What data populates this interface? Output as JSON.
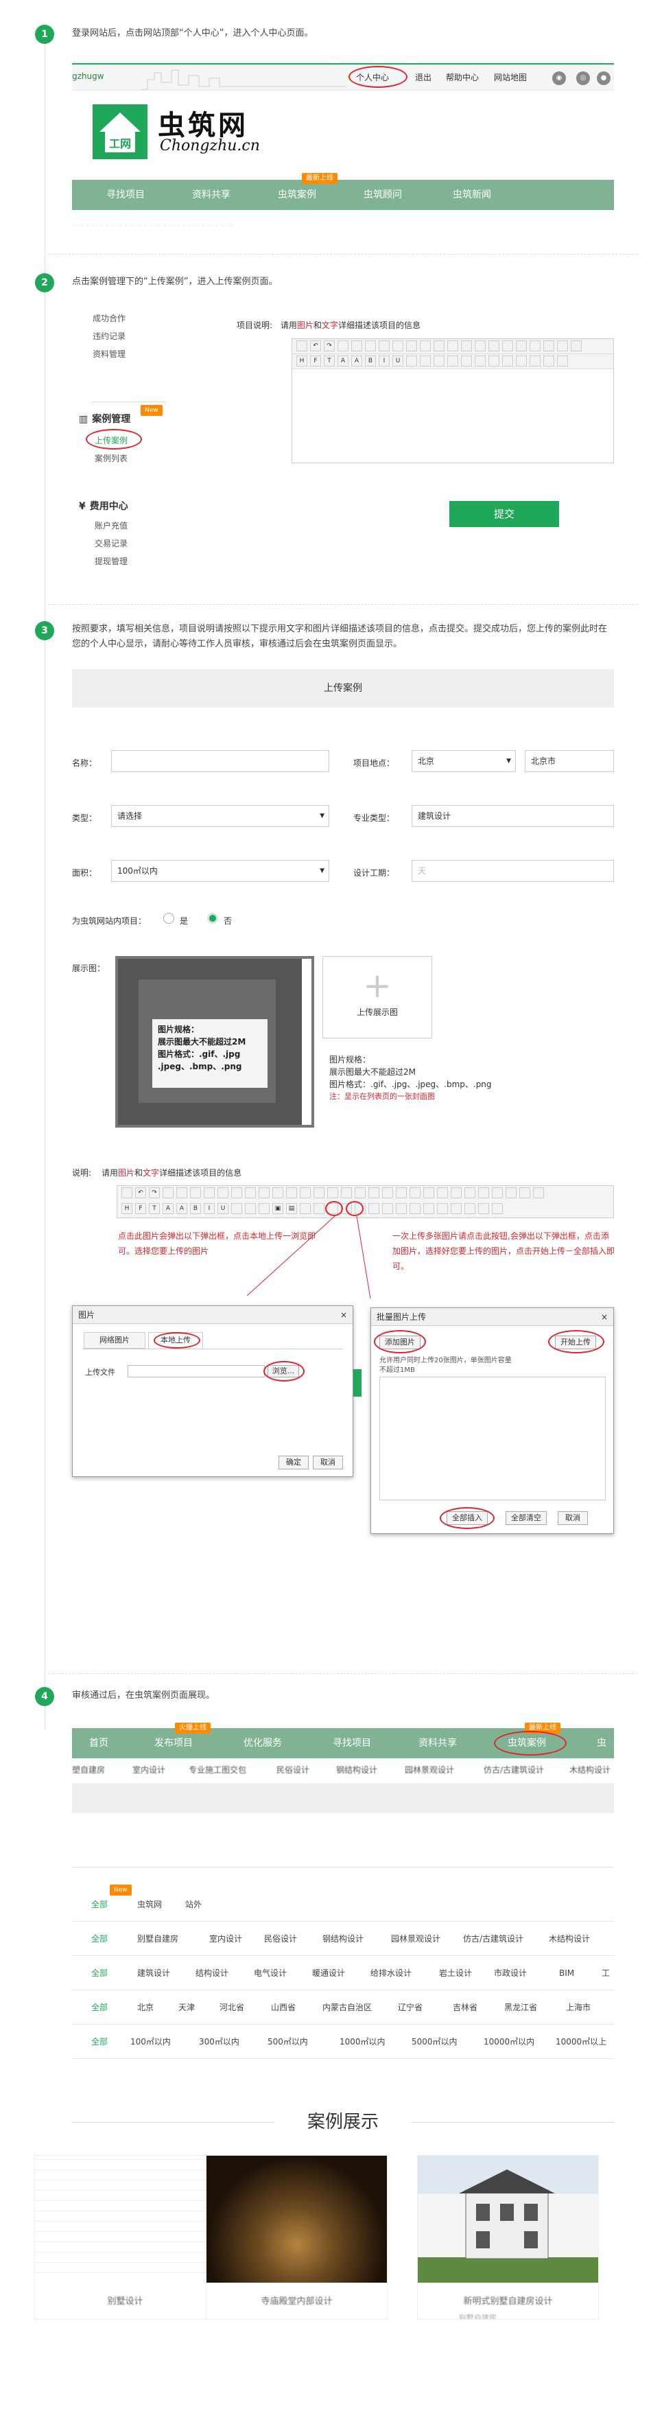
{
  "steps": [
    {
      "num": "1",
      "text": "登录网站后，点击网站顶部“个人中心”，进入个人中心页面。"
    },
    {
      "num": "2",
      "text": "点击案例管理下的“上传案例”，进入上传案例页面。"
    },
    {
      "num": "3",
      "text": "按照要求，填写相关信息，项目说明请按照以下提示用文字和图片详细描述该项目的信息，点击提交。提交成功后，您上传的案例此时在您的个人中心显示，请耐心等待工作人员审核，审核通过后会在虫筑案例页面显示。"
    },
    {
      "num": "4",
      "text": "审核通过后，在虫筑案例页面展现。"
    }
  ],
  "s1": {
    "username": "gzhugw",
    "top_links": [
      "个人中心",
      "退出",
      "帮助中心",
      "网站地图"
    ],
    "logo_cn": "虫筑网",
    "logo_en": "Chongzhu.cn",
    "logo_mark": "工网",
    "badge": "最新上线",
    "nav": [
      "寻找项目",
      "资料共享",
      "虫筑案例",
      "虫筑顾问",
      "虫筑新闻"
    ]
  },
  "s2": {
    "menu_top": [
      "成功合作",
      "违约记录",
      "资料管理"
    ],
    "case_title": "案例管理",
    "new_badge": "New",
    "case_items": [
      "上传案例",
      "案例列表"
    ],
    "fee_title": "费用中心",
    "fee_items": [
      "账户充值",
      "交易记录",
      "提现管理"
    ],
    "desc_label": "项目说明:",
    "desc_hint_pre": "请用",
    "desc_hint_img": "图片",
    "desc_hint_and": "和",
    "desc_hint_text": "文字",
    "desc_hint_post": "详细描述该项目的信息",
    "submit": "提交"
  },
  "s3": {
    "form_title": "上传案例",
    "name_label": "名称：",
    "location_label": "项目地点：",
    "province": "北京",
    "city": "北京市",
    "type_label": "类型：",
    "type_value": "请选择",
    "major_label": "专业类型：",
    "major_value": "建筑设计",
    "area_label": "面积：",
    "area_value": "100㎡以内",
    "period_label": "设计工期：",
    "period_placeholder": "天",
    "internal_label": "为虫筑网站内项目：",
    "opt_yes": "是",
    "opt_no": "否",
    "display_label": "展示图：",
    "preview_lines": [
      "图片规格：",
      "展示图最大不能超过2M",
      "图片格式：.gif、.jpg",
      ".jpeg、.bmp、.png"
    ],
    "upload_btn": "上传展示图",
    "spec_lines": [
      "图片规格：",
      "展示图最大不能超过2M",
      "图片格式：.gif、.jpg、.jpeg、.bmp、.png"
    ],
    "spec_note": "注：显示在列表页的一张封面图",
    "desc_label": "说明:",
    "annot_left": "点击此图片会弹出以下弹出框，点击本地上传一浏览即可。选择您要上传的图片",
    "annot_right": "一次上传多张图片请点击此按钮,会弹出以下弹出框，点击添加图片，选择好您要上传的图片，点击开始上传－全部插入即可。",
    "dlg1_title": "图片",
    "dlg1_tabs": [
      "网络图片",
      "本地上传"
    ],
    "dlg1_file_label": "上传文件",
    "dlg1_browse": "浏览...",
    "dlg1_ok": "确定",
    "dlg1_cancel": "取消",
    "dlg2_title": "批量图片上传",
    "dlg2_add": "添加图片",
    "dlg2_start": "开始上传",
    "dlg2_note": "允许用户同时上传20张图片，单张图片容量不超过1MB",
    "dlg2_insert": "全部插入",
    "dlg2_clear": "全部清空",
    "dlg2_cancel": "取消",
    "close": "×"
  },
  "s4": {
    "nav": [
      "首页",
      "发布项目",
      "优化服务",
      "寻找项目",
      "资料共享",
      "虫筑案例",
      "虫"
    ],
    "badge1": "火爆上线",
    "badge2": "最新上线",
    "subnav": [
      "塑自建房",
      "室内设计",
      "专业施工图交包",
      "民俗设计",
      "钢结构设计",
      "园林景观设计",
      "仿古/古建筑设计",
      "木结构设计"
    ]
  },
  "filters": {
    "new_badge": "New",
    "rows": [
      [
        "全部",
        "虫筑网",
        "站外"
      ],
      [
        "全部",
        "别墅自建房",
        "室内设计",
        "民俗设计",
        "钢结构设计",
        "园林景观设计",
        "仿古/古建筑设计",
        "木结构设计"
      ],
      [
        "全部",
        "建筑设计",
        "结构设计",
        "电气设计",
        "暖通设计",
        "给排水设计",
        "岩土设计",
        "市政设计",
        "BIM",
        "工"
      ],
      [
        "全部",
        "北京",
        "天津",
        "河北省",
        "山西省",
        "内蒙古自治区",
        "辽宁省",
        "吉林省",
        "黑龙江省",
        "上海市"
      ],
      [
        "全部",
        "100㎡以内",
        "300㎡以内",
        "500㎡以内",
        "1000㎡以内",
        "5000㎡以内",
        "10000㎡以内",
        "10000㎡以上"
      ]
    ]
  },
  "cases": {
    "title": "案例展示",
    "items": [
      "别墅设计",
      "寺庙殿堂内部设计",
      "新明式别墅自建房设计"
    ],
    "subtitle": "别墅自建房"
  }
}
